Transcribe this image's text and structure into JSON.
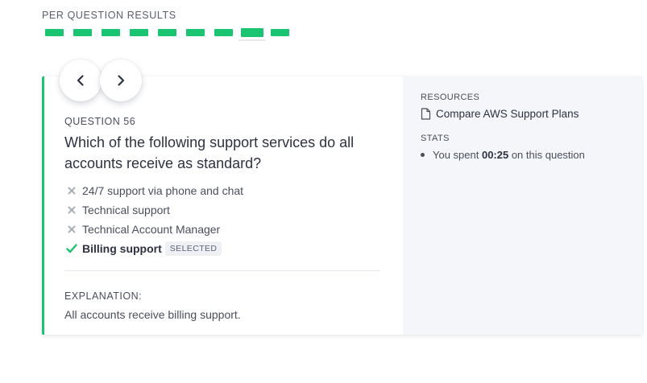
{
  "results": {
    "title": "PER QUESTION RESULTS",
    "dashes": [
      {
        "status": "correct",
        "active": false
      },
      {
        "status": "correct",
        "active": false
      },
      {
        "status": "correct",
        "active": false
      },
      {
        "status": "correct",
        "active": false
      },
      {
        "status": "correct",
        "active": false
      },
      {
        "status": "correct",
        "active": false
      },
      {
        "status": "correct",
        "active": false
      },
      {
        "status": "correct",
        "active": true
      },
      {
        "status": "correct",
        "active": false
      }
    ],
    "correct_color": "#1bc471"
  },
  "nav": {
    "prev_icon": "chevron-left-icon",
    "next_icon": "chevron-right-icon"
  },
  "question": {
    "number_label": "QUESTION 56",
    "text": "Which of the following support services do all accounts receive as standard?",
    "answers": [
      {
        "text": "24/7 support via phone and chat",
        "icon": "x-icon",
        "correct": false
      },
      {
        "text": "Technical support",
        "icon": "x-icon",
        "correct": false
      },
      {
        "text": "Technical Account Manager",
        "icon": "x-icon",
        "correct": false
      },
      {
        "text": "Billing support",
        "icon": "check-icon",
        "correct": true,
        "badge": "SELECTED"
      }
    ],
    "explanation_title": "EXPLANATION:",
    "explanation_text": "All accounts receive billing support."
  },
  "sidebar": {
    "resources_title": "RESOURCES",
    "resource_link": "Compare AWS Support Plans",
    "resource_icon": "document-icon",
    "stats_title": "STATS",
    "stats_prefix": "You spent ",
    "stats_time": "00:25",
    "stats_suffix": " on this question"
  }
}
